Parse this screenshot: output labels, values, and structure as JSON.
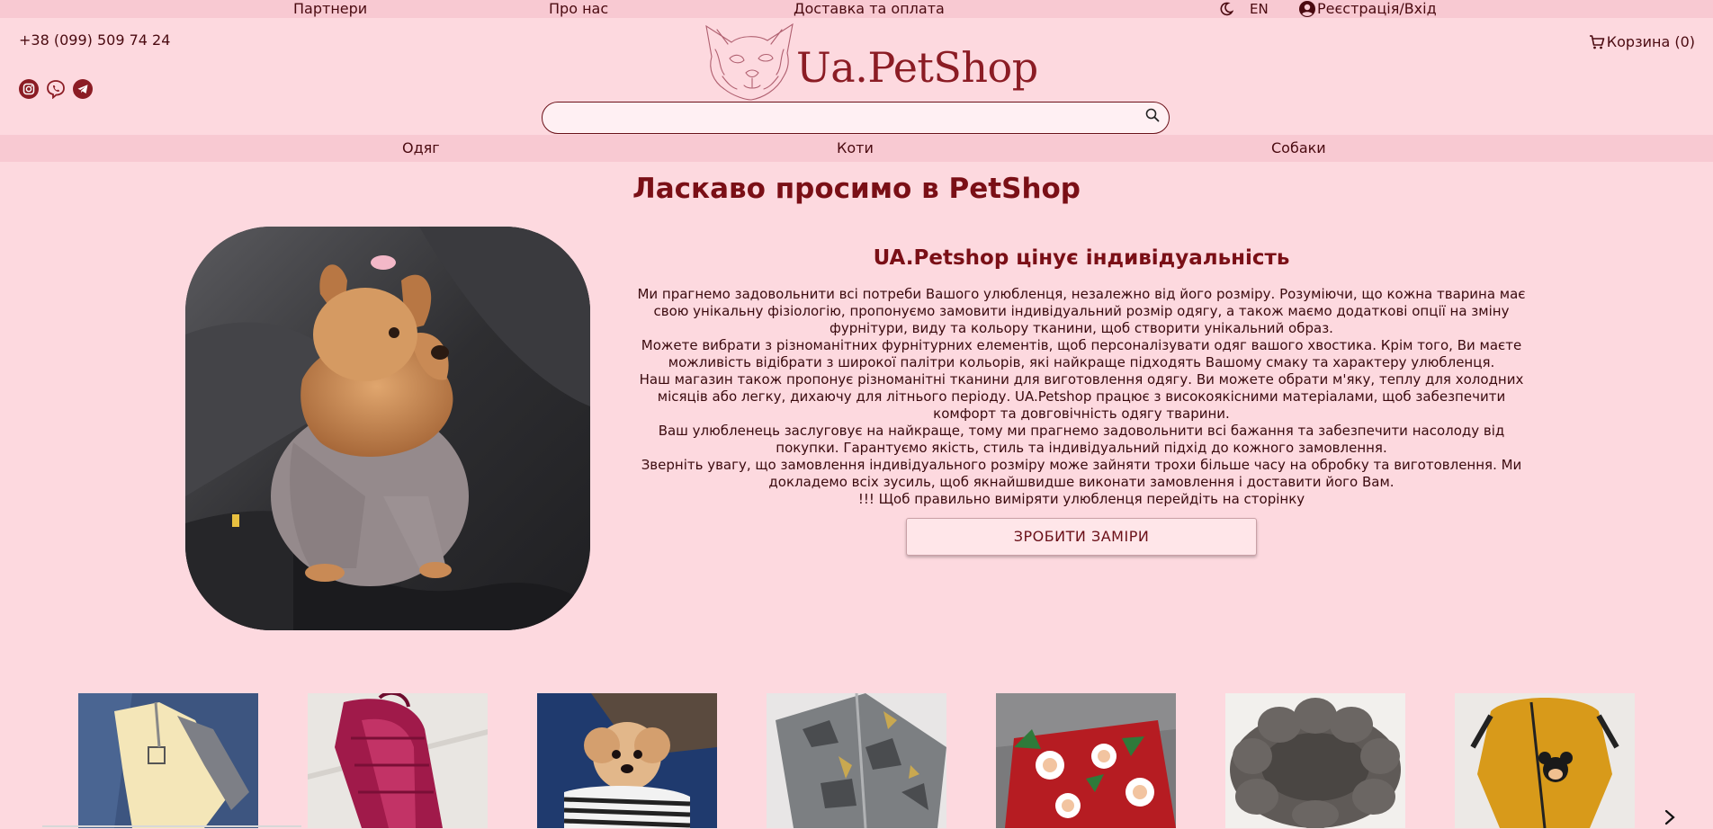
{
  "topnav": {
    "partners": "Партнери",
    "about": "Про нас",
    "delivery": "Доставка та оплата",
    "lang": "EN",
    "account": "Реєстрація/Вхід"
  },
  "header": {
    "phone": "+38 (099) 509 74 24",
    "logo_text": "Ua.PetShop",
    "cart": "Корзина (0)",
    "search_value": "",
    "socials": [
      "instagram-icon",
      "viber-icon",
      "telegram-icon"
    ]
  },
  "categories": [
    "Одяг",
    "Коти",
    "Собаки"
  ],
  "main": {
    "title": "Ласкаво просимо в PetShop",
    "subtitle": "UA.Petshop цінує індивідуальність",
    "paragraphs": [
      "Ми прагнемо задовольнити всі потреби Вашого улюбленця, незалежно від його розміру. Розуміючи, що кожна тварина має свою унікальну фізіологію, пропонуємо замовити індивідуальний розмір одягу, а також маємо додаткові опції на зміну фурнітури, виду та кольору тканини, щоб створити унікальний образ.",
      "Можете вибрати з різноманітних фурнітурних елементів, щоб персоналізувати одяг вашого хвостика. Крім того, Ви маєте можливість відібрати з широкої палітри кольорів, які найкраще підходять Вашому смаку та характеру улюбленця.",
      "Наш магазин також пропонує різноманітні тканини для виготовлення одягу. Ви можете обрати м'яку, теплу для холодних місяців або легку, дихаючу для літнього періоду. UA.Petshop працює з високоякісними матеріалами, щоб забезпечити комфорт та довговічність одягу тварини.",
      "Ваш улюбленець заслуговує на найкраще, тому ми прагнемо задовольнити всі бажання та забезпечити насолоду від покупки. Гарантуємо якість, стиль та індивідуальний підхід до кожного замовлення.",
      "Зверніть увагу, що замовлення індивідуального розміру може зайняти трохи більше часу на обробку та виготовлення. Ми докладемо всіх зусиль, щоб якнайшвидше виконати замовлення і доставити його Вам.",
      "!!! Щоб правильно виміряти улюбленця перейдіть на сторінку"
    ],
    "button": "ЗРОБИТИ ЗАМІРИ"
  },
  "colors": {
    "background": "#fdd9df",
    "bar": "#f8c9d2",
    "accent": "#8b1c24"
  }
}
